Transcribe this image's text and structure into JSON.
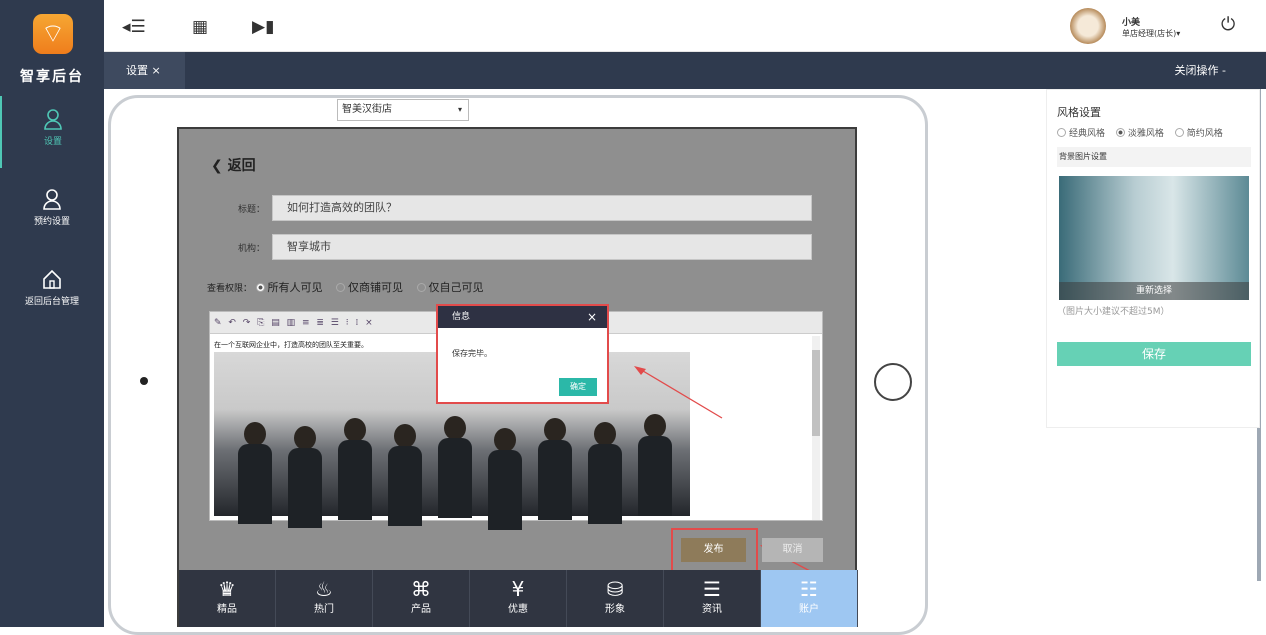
{
  "sidebar": {
    "brand": "智享后台",
    "items": [
      {
        "label": "设置",
        "active": true
      },
      {
        "label": "预约设置"
      },
      {
        "label": "返回后台管理"
      }
    ]
  },
  "topbar": {
    "user_name": "小美",
    "user_role": "单店经理(店长)▾"
  },
  "tabbar": {
    "tab_label": "设置 ×",
    "close_ops": "关闭操作 -"
  },
  "preview": {
    "store_select": "智美汉街店",
    "back": "返回",
    "title_label": "标题：",
    "title_value": "如何打造高效的团队？",
    "org_label": "机构：",
    "org_value": "智享城市",
    "perm_label": "查看权限：",
    "perm_options": [
      "所有人可见",
      "仅商铺可见",
      "仅自己可见"
    ],
    "editor_text": "在一个互联网企业中，打造高校的团队至关重要。",
    "dialog": {
      "title": "信息",
      "close": "×",
      "message": "保存完毕。",
      "ok": "确定"
    },
    "publish": "发布",
    "cancel": "取消",
    "nav": [
      {
        "label": "精品",
        "glyph": "♛"
      },
      {
        "label": "热门",
        "glyph": "♨"
      },
      {
        "label": "产品",
        "glyph": "⌘"
      },
      {
        "label": "优惠",
        "glyph": "¥"
      },
      {
        "label": "形象",
        "glyph": "⛁"
      },
      {
        "label": "资讯",
        "glyph": "☰"
      },
      {
        "label": "账户",
        "glyph": "☷"
      }
    ]
  },
  "panel": {
    "heading": "风格设置",
    "styles": [
      "经典风格",
      "淡雅风格",
      "简约风格"
    ],
    "selected_style": "淡雅风格",
    "bg_label": "背景图片设置",
    "reselect": "重新选择",
    "hint": "（图片大小建议不超过5M）",
    "save": "保存"
  }
}
